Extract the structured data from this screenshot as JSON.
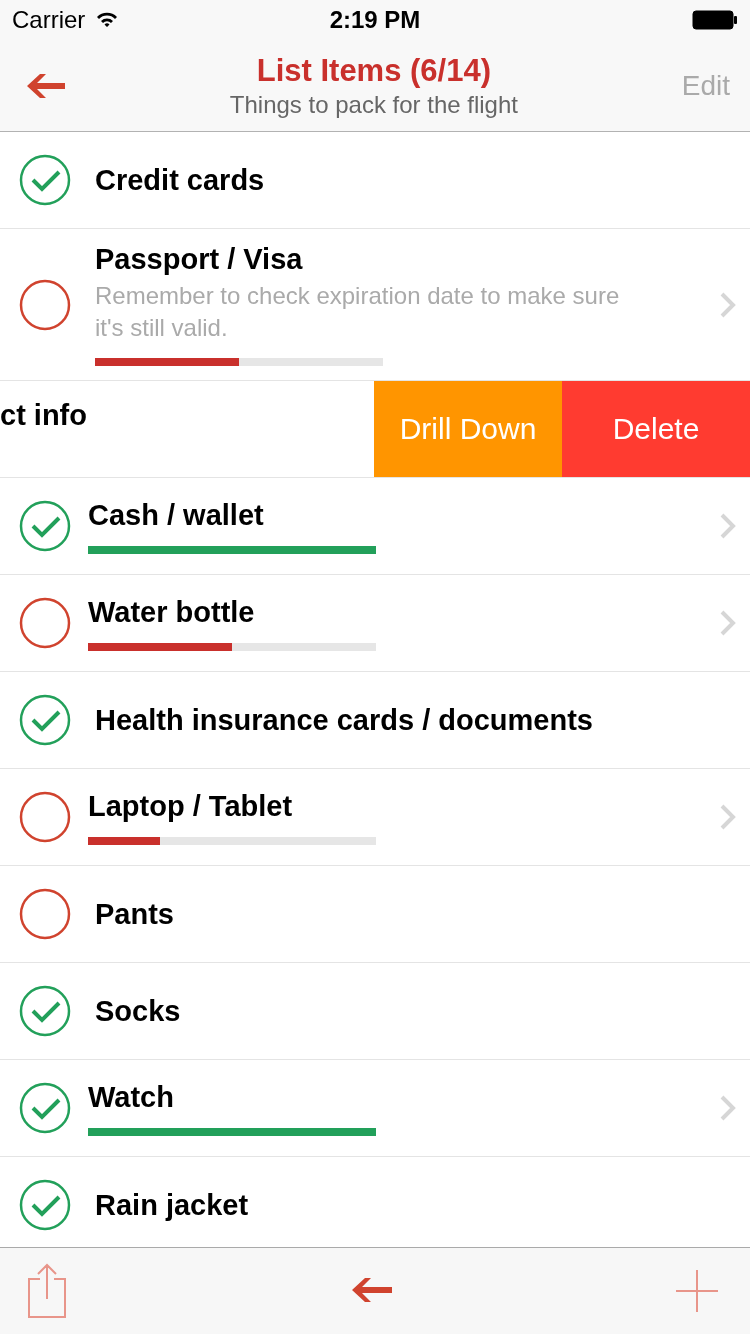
{
  "status_bar": {
    "carrier": "Carrier",
    "time": "2:19 PM"
  },
  "nav": {
    "title": "List Items (6/14)",
    "subtitle": "Things to pack for the flight",
    "edit": "Edit"
  },
  "items": [
    {
      "kind": "item",
      "title": "Credit cards",
      "checked": true,
      "disclosure": false
    },
    {
      "kind": "item",
      "title": "Passport / Visa",
      "note": "Remember to check expiration date to make sure it's still valid.",
      "checked": false,
      "disclosure": true,
      "progress": {
        "level": 0.5
      }
    },
    {
      "kind": "swiped",
      "title": "ct info",
      "actions": [
        {
          "label": "Drill Down",
          "kind": "drill"
        },
        {
          "label": "Delete",
          "kind": "delete"
        }
      ]
    },
    {
      "kind": "item",
      "title": "Cash / wallet",
      "checked": true,
      "disclosure": true,
      "progress": {
        "level": 1
      }
    },
    {
      "kind": "item",
      "title": "Water bottle",
      "checked": false,
      "disclosure": true,
      "progress": {
        "level": 0.5
      }
    },
    {
      "kind": "item",
      "title": "Health insurance cards / documents",
      "checked": true,
      "disclosure": false
    },
    {
      "kind": "item",
      "title": "Laptop / Tablet",
      "checked": false,
      "disclosure": true,
      "progress": {
        "level": 0.25
      }
    },
    {
      "kind": "item",
      "title": "Pants",
      "checked": false,
      "disclosure": false
    },
    {
      "kind": "item",
      "title": "Socks",
      "checked": true,
      "disclosure": false
    },
    {
      "kind": "item",
      "title": "Watch",
      "checked": true,
      "disclosure": true,
      "progress": {
        "level": 1
      }
    },
    {
      "kind": "item",
      "title": "Rain jacket",
      "checked": true,
      "disclosure": false
    }
  ]
}
